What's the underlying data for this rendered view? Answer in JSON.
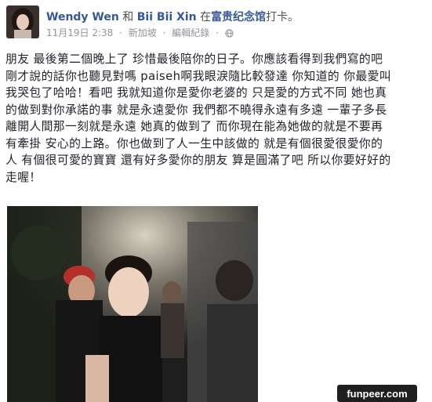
{
  "post": {
    "author": "Wendy Wen",
    "with_word": "和",
    "partner": "Bii Bii Xin",
    "checkin_prefix": "在",
    "place": "富贵纪念馆",
    "checkin_suffix": "打卡。",
    "date": "11月19日 2:38",
    "dot1": "·",
    "location": "新加坡",
    "dot2": "·",
    "edit_label": "編輯紀錄",
    "dot3": "·",
    "privacy_icon": "globe-icon",
    "text_lines": [
      "朋友 最後第二個晚上了 珍惜最後陪你的日子。你應該看得到我們寫的吧",
      "剛才說的話你也聽見對嗎 paiseh啊我眼淚隨比較發達 你知道的 你最愛叫",
      "我哭包了哈哈！看吧 我就知道你是愛你老婆的 只是愛的方式不同 她也真",
      "的做到對你承諾的事 就是永遠愛你 我們都不曉得永遠有多遠 一輩子多長",
      "離開人間那一刻就是永遠 她真的做到了 而你現在能為她做的就是不要再",
      "有牽掛 安心的上路。你也做到了人一生中該做的 就是有個很愛很愛你的",
      "人 有個很可愛的寶寶 還有好多愛你的朋友 算是圓滿了吧 所以你要好好的",
      "走喔！"
    ]
  },
  "watermark": "funpeer.com",
  "colors": {
    "link_blue": "#365899",
    "text": "#1d2129",
    "meta_gray": "#90949c"
  }
}
